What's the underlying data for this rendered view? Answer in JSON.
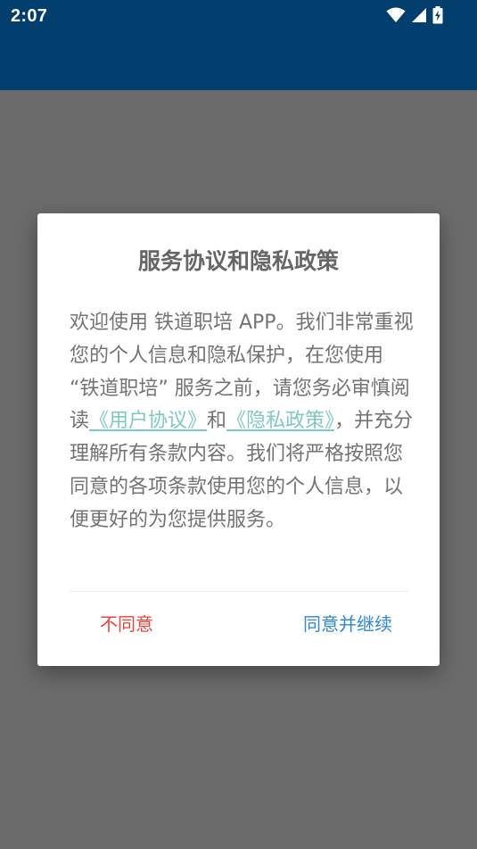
{
  "status_bar": {
    "time": "2:07",
    "icons": [
      "wifi-icon",
      "cellular-signal-icon",
      "battery-charging-icon"
    ],
    "background_color": "#023e6e"
  },
  "dialog": {
    "title": "服务协议和隐私政策",
    "body": {
      "part1": "欢迎使用 铁道职培 APP。我们非常重视您的个人信息和隐私保护，在您使用 “铁道职培” 服务之前，请您务必审慎阅读",
      "user_agreement_link": "《用户协议》",
      "connector": "和",
      "privacy_policy_link": "《隐私政策》",
      "part2": "，并充分理解所有条款内容。我们将严格按照您同意的各项条款使用您的个人信息，以便更好的为您提供服务。"
    },
    "buttons": {
      "disagree": "不同意",
      "agree": "同意并继续"
    },
    "colors": {
      "link": "#7ec9c2",
      "disagree": "#e5463b",
      "agree": "#2f86d1"
    }
  }
}
